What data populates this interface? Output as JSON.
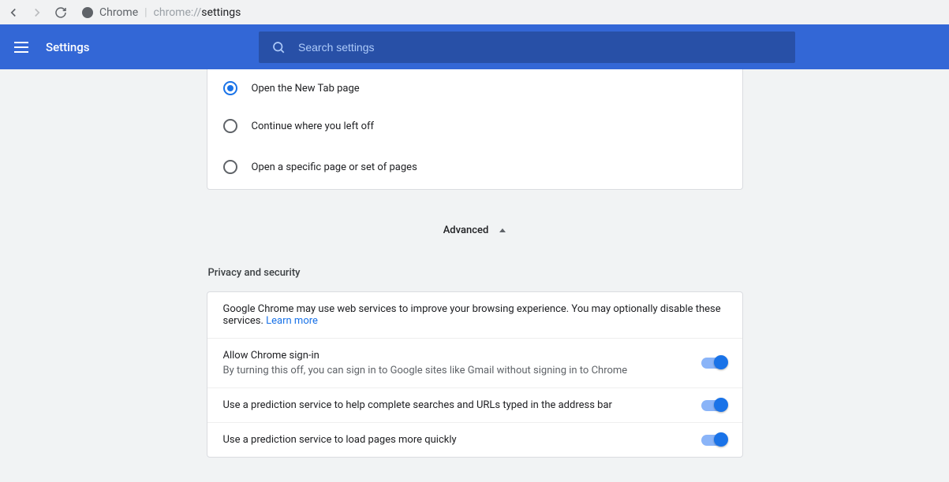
{
  "browser": {
    "label": "Chrome",
    "url_gray": "chrome://",
    "url_black": "settings"
  },
  "header": {
    "title": "Settings",
    "search_placeholder": "Search settings"
  },
  "startup": {
    "options": [
      {
        "label": "Open the New Tab page",
        "selected": true
      },
      {
        "label": "Continue where you left off",
        "selected": false
      },
      {
        "label": "Open a specific page or set of pages",
        "selected": false
      }
    ]
  },
  "advanced_label": "Advanced",
  "privacy": {
    "section_title": "Privacy and security",
    "intro": "Google Chrome may use web services to improve your browsing experience. You may optionally disable these services.",
    "learn_more": "Learn more",
    "items": [
      {
        "title": "Allow Chrome sign-in",
        "subtitle": "By turning this off, you can sign in to Google sites like Gmail without signing in to Chrome",
        "toggle": true
      },
      {
        "title": "Use a prediction service to help complete searches and URLs typed in the address bar",
        "subtitle": "",
        "toggle": true
      },
      {
        "title": "Use a prediction service to load pages more quickly",
        "subtitle": "",
        "toggle": true
      }
    ]
  }
}
